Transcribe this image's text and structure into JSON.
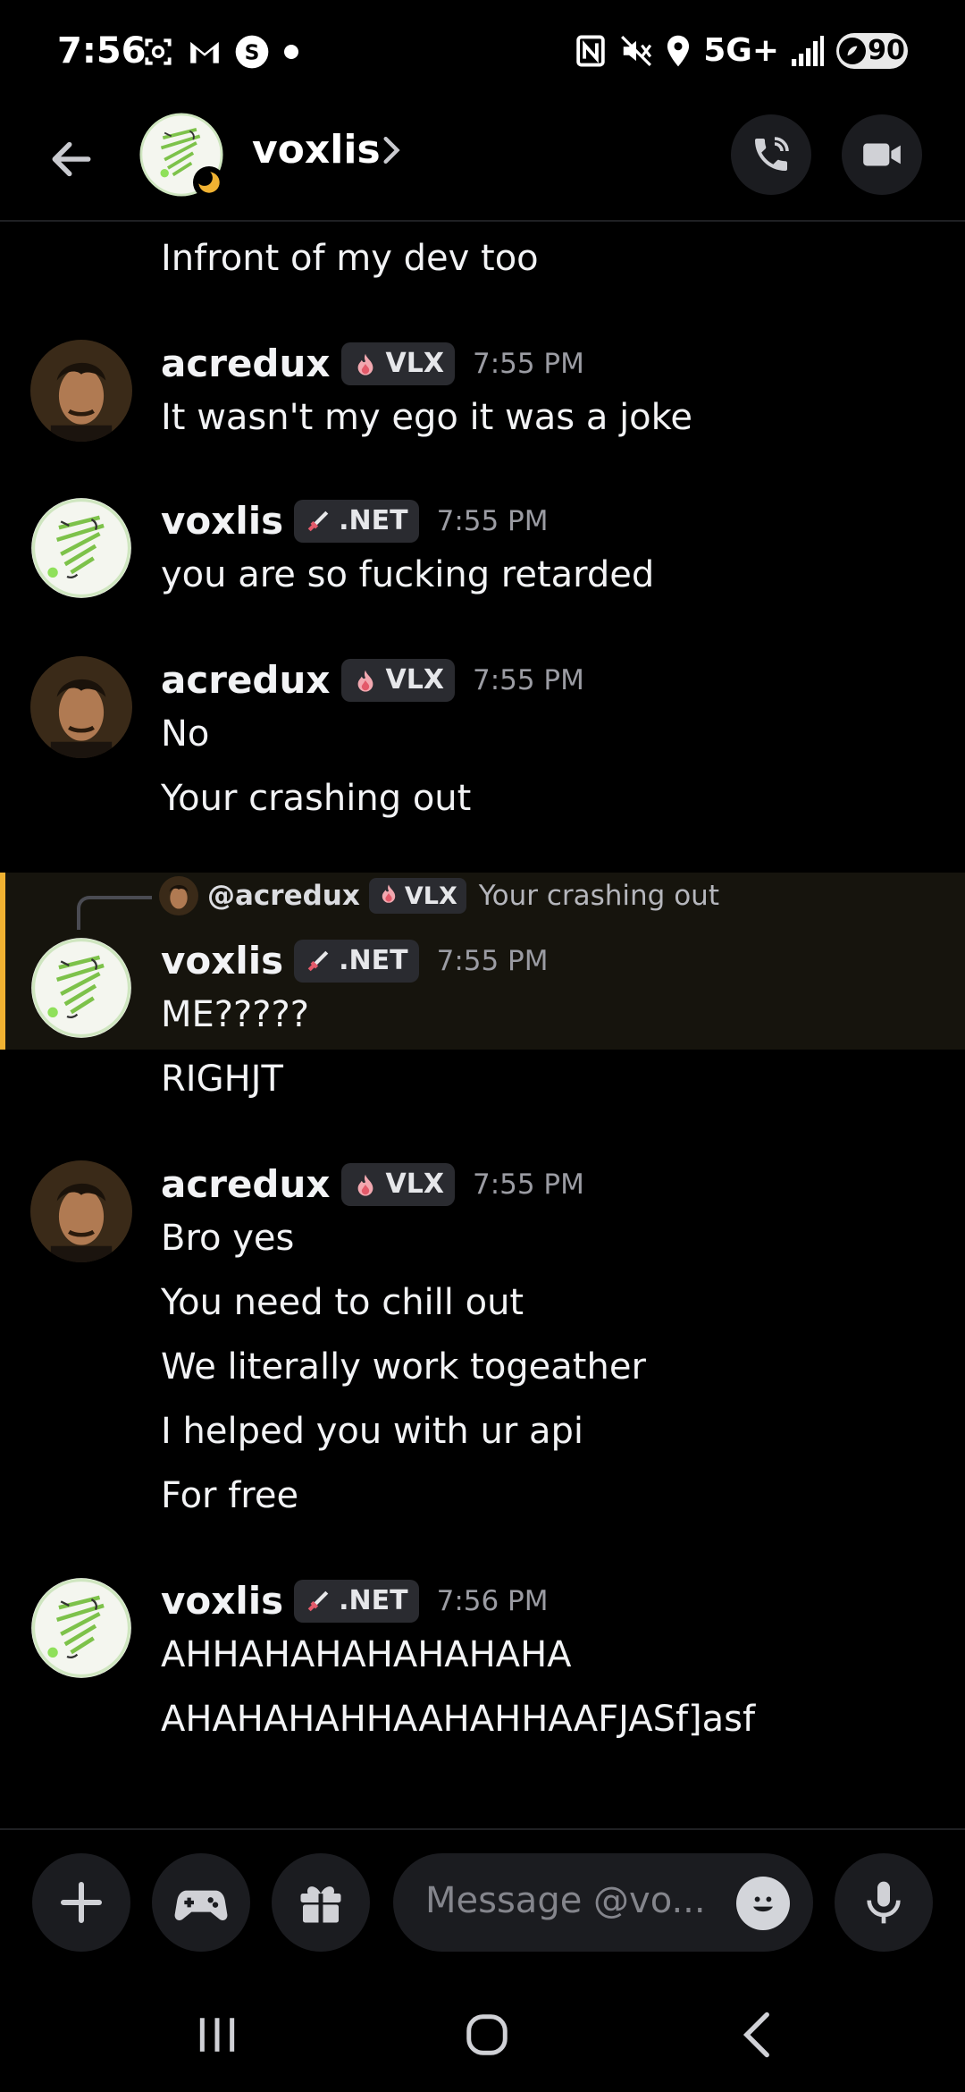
{
  "status_bar": {
    "time": "7:56",
    "network": "5G+",
    "battery": "90"
  },
  "header": {
    "username": "voxlis"
  },
  "reply_preview": {
    "author": "@acredux",
    "tag": "VLX",
    "text": "Your crashing out"
  },
  "messages": [
    {
      "lines": [
        "Infront of my dev too"
      ]
    },
    {
      "author": "acredux",
      "tag": "VLX",
      "time": "7:55 PM",
      "lines": [
        "It wasn't my ego it was a joke"
      ]
    },
    {
      "author": "voxlis",
      "tag": ".NET",
      "time": "7:55 PM",
      "lines": [
        "you are so fucking retarded"
      ]
    },
    {
      "author": "acredux",
      "tag": "VLX",
      "time": "7:55 PM",
      "lines": [
        "No",
        "Your crashing out"
      ]
    },
    {
      "author": "voxlis",
      "tag": ".NET",
      "time": "7:55 PM",
      "lines": [
        "ME?????",
        "RIGHJT"
      ]
    },
    {
      "author": "acredux",
      "tag": "VLX",
      "time": "7:55 PM",
      "lines": [
        "Bro yes",
        "You need to chill out",
        "We literally work togeather",
        "I helped you with ur api",
        "For free"
      ]
    },
    {
      "author": "voxlis",
      "tag": ".NET",
      "time": "7:56 PM",
      "lines": [
        "AHHAHAHAHAHAHAHA",
        "AHAHAHAHHAAHAHHAAFJASf]asf"
      ]
    }
  ],
  "composer": {
    "placeholder": "Message @vo..."
  },
  "colors": {
    "background": "#000000",
    "highlight_bar": "#f0b232",
    "highlight_bg": "#16140d",
    "tag_bg": "#2a2b30",
    "timestamp": "#9b9ca3",
    "status_dot": "#f0b232"
  }
}
